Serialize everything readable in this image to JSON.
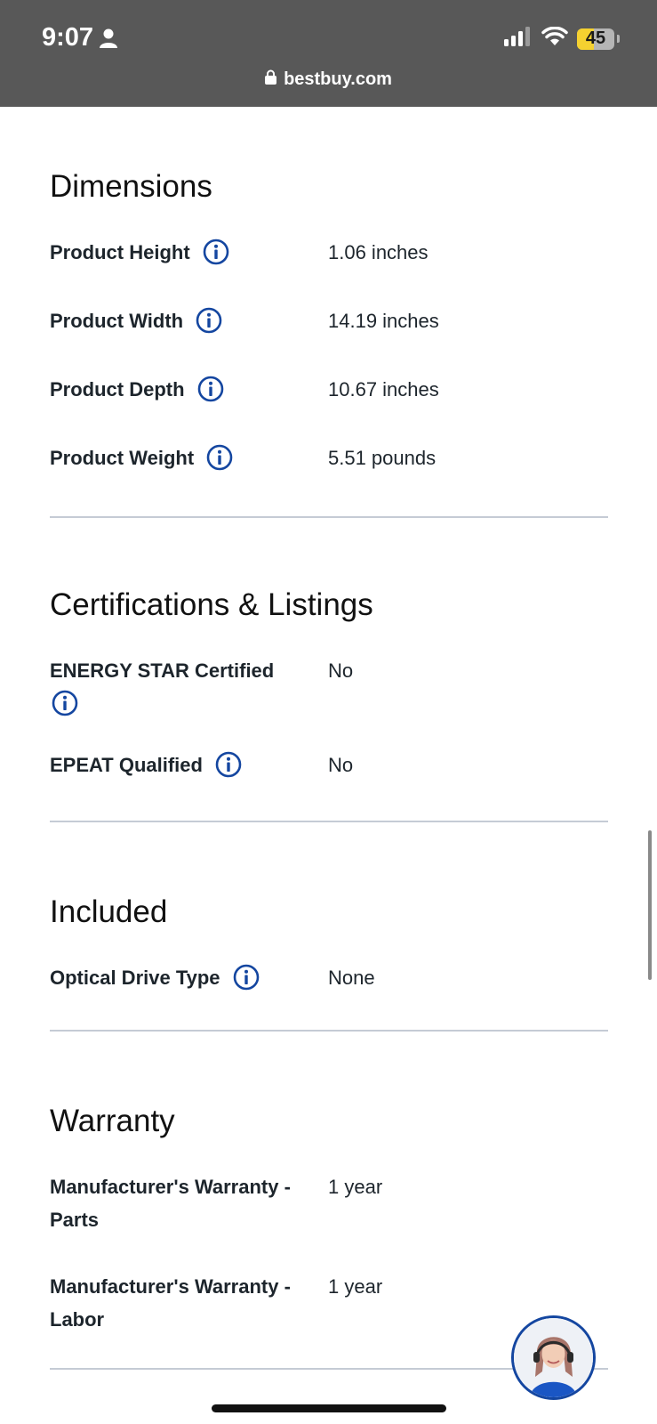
{
  "status_bar": {
    "time": "9:07",
    "battery": "45",
    "url": "bestbuy.com"
  },
  "colors": {
    "info_icon": "#1446a0",
    "status_bar_bg": "#585858",
    "divider": "#c5cbd5",
    "battery_fill": "#f5d130"
  },
  "icons": {
    "info": "info-circle-icon",
    "lock": "lock-icon",
    "person": "person-icon",
    "signal": "cellular-signal-icon",
    "wifi": "wifi-icon",
    "chat": "chat-agent-avatar"
  },
  "sections": [
    {
      "title": "Dimensions",
      "rows": [
        {
          "label": "Product Height",
          "value": "1.06 inches",
          "info": true
        },
        {
          "label": "Product Width",
          "value": "14.19 inches",
          "info": true
        },
        {
          "label": "Product Depth",
          "value": "10.67 inches",
          "info": true
        },
        {
          "label": "Product Weight",
          "value": "5.51 pounds",
          "info": true
        }
      ]
    },
    {
      "title": "Certifications & Listings",
      "rows": [
        {
          "label": "ENERGY STAR Certified",
          "value": "No",
          "info": true
        },
        {
          "label": "EPEAT Qualified",
          "value": "No",
          "info": true
        }
      ]
    },
    {
      "title": "Included",
      "rows": [
        {
          "label": "Optical Drive Type",
          "value": "None",
          "info": true
        }
      ]
    },
    {
      "title": "Warranty",
      "rows": [
        {
          "label": "Manufacturer's Warranty - Parts",
          "value": "1 year",
          "info": false
        },
        {
          "label": "Manufacturer's Warranty - Labor",
          "value": "1 year",
          "info": false
        }
      ]
    }
  ]
}
